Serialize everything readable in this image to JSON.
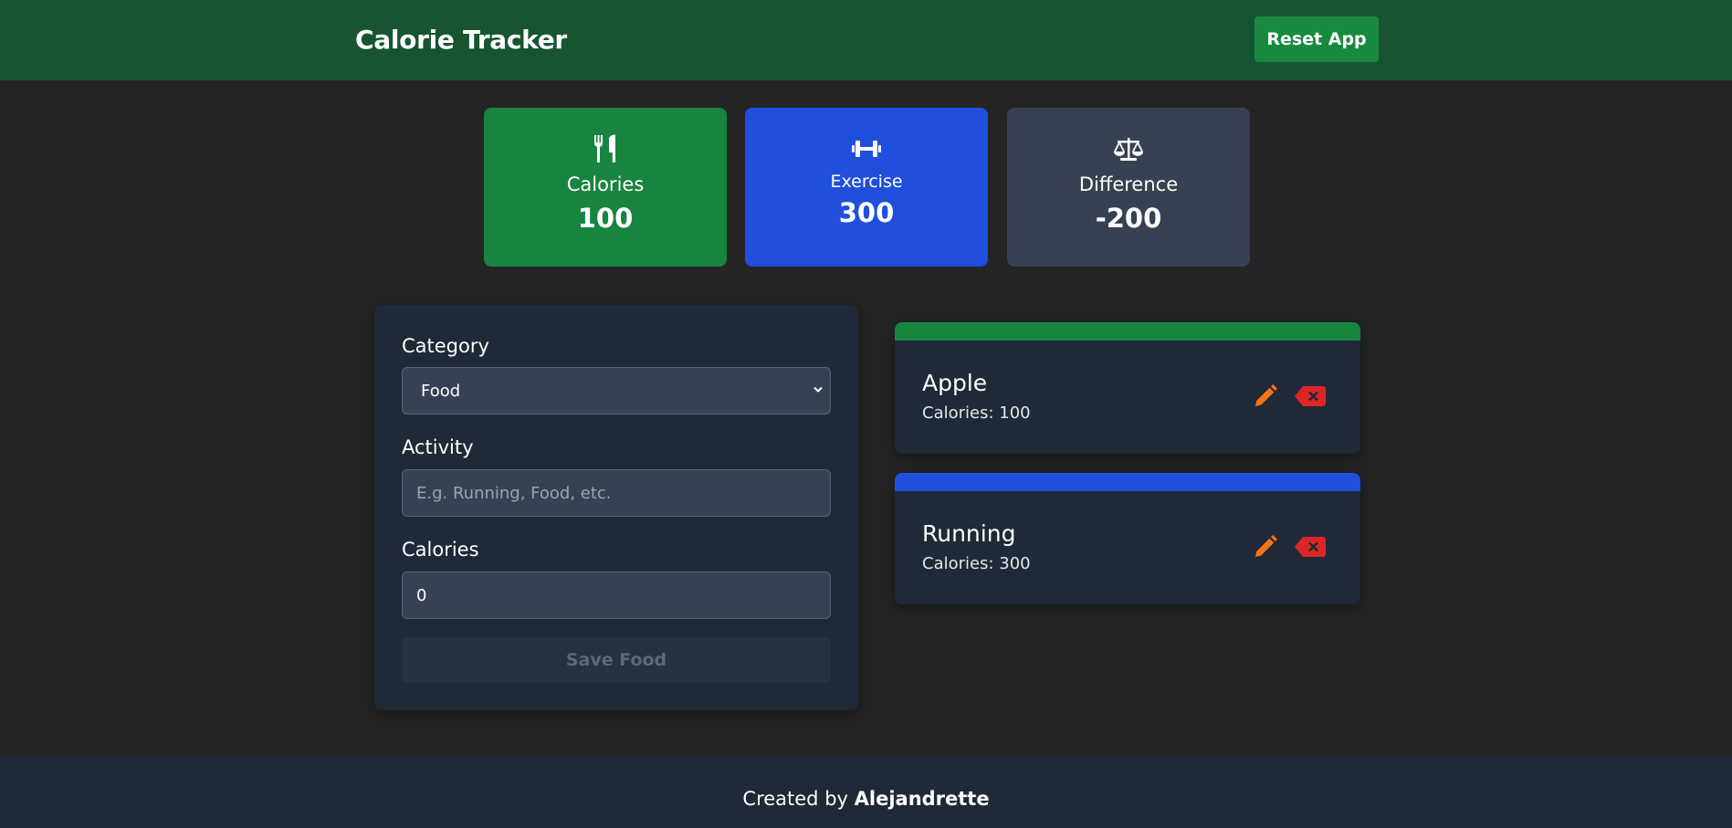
{
  "header": {
    "title": "Calorie Tracker",
    "reset_label": "Reset App"
  },
  "stats": {
    "calories": {
      "label": "Calories",
      "value": "100",
      "icon": "utensils-icon",
      "color": "#188440"
    },
    "exercise": {
      "label": "Exercise",
      "value": "300",
      "icon": "dumbbell-icon",
      "color": "#1f4fdc"
    },
    "difference": {
      "label": "Difference",
      "value": "-200",
      "icon": "scale-icon",
      "color": "#374151"
    }
  },
  "form": {
    "category_label": "Category",
    "category_options": [
      "Food"
    ],
    "category_selected": "Food",
    "activity_label": "Activity",
    "activity_value": "",
    "activity_placeholder": "E.g. Running, Food, etc.",
    "calories_label": "Calories",
    "calories_value": "0",
    "save_label": "Save Food"
  },
  "activities": [
    {
      "name": "Apple",
      "calories_text": "Calories: 100",
      "category": "food",
      "strip_color": "#188440"
    },
    {
      "name": "Running",
      "calories_text": "Calories: 300",
      "category": "exercise",
      "strip_color": "#1f4fdc"
    }
  ],
  "footer": {
    "prefix": "Created by ",
    "author": "Alejandrette"
  },
  "colors": {
    "header_bg": "#175532",
    "page_bg": "#242424",
    "panel_bg": "#1f2937",
    "edit_icon": "#f97316",
    "delete_icon": "#dc2626"
  }
}
